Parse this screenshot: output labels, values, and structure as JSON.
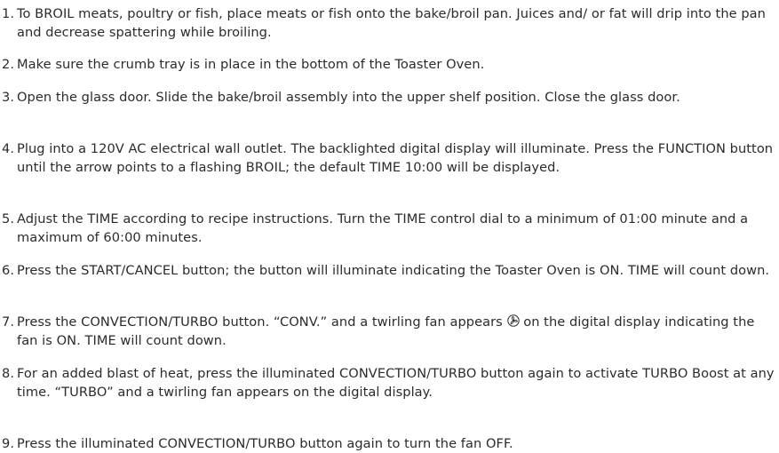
{
  "colors": {
    "text": "#2b2b2b",
    "background": "#ffffff"
  },
  "steps": [
    {
      "number": "1.",
      "text": "To BROIL meats, poultry or fish, place meats or fish onto the bake/broil pan. Juices and/ or fat will drip into the pan and decrease spattering while broiling."
    },
    {
      "number": "2.",
      "text": "Make sure the crumb tray is in place in the bottom of the Toaster Oven."
    },
    {
      "number": "3.",
      "text": "Open the glass door. Slide the bake/broil assembly into the upper shelf position. Close the glass door."
    },
    {
      "number": "4.",
      "text": "Plug into a 120V AC electrical wall outlet. The backlighted digital display will illuminate. Press the FUNCTION button until the arrow points to a flashing BROIL; the default TIME 10:00 will be displayed."
    },
    {
      "number": "5.",
      "text": "Adjust the TIME according to recipe instructions. Turn the TIME control dial to a minimum of 01:00 minute and a maximum of 60:00 minutes."
    },
    {
      "number": "6.",
      "text": "Press the START/CANCEL button; the button will illuminate indicating the Toaster Oven is ON. TIME will count down."
    },
    {
      "number": "7.",
      "text_before_icon": "Press the CONVECTION/TURBO button. “CONV.” and a twirling fan appears ",
      "icon": "fan-icon",
      "text_after_icon": " on the digital display indicating the fan is ON. TIME will count down."
    },
    {
      "number": "8.",
      "text": "For an added blast of heat, press the illuminated CONVECTION/TURBO button again to activate TURBO Boost at any time. “TURBO” and a twirling fan appears on the digital display."
    },
    {
      "number": "9.",
      "text": "Press the illuminated CONVECTION/TURBO button again to turn the fan OFF."
    }
  ]
}
